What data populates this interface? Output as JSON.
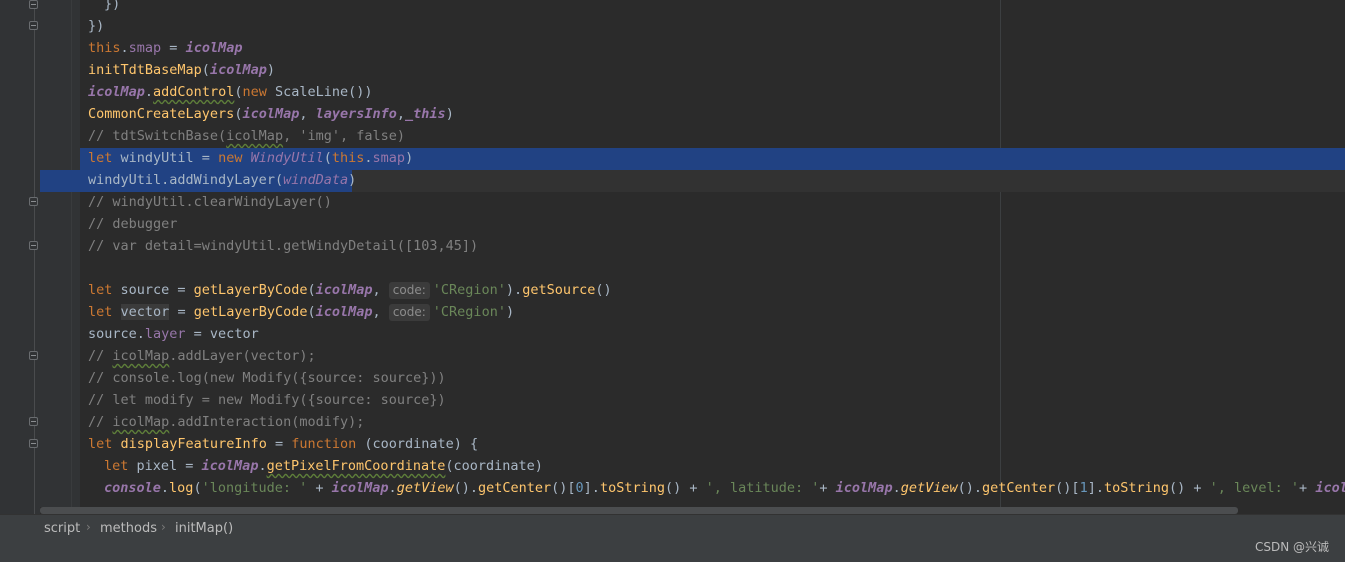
{
  "breadcrumb": {
    "items": [
      "script",
      "methods",
      "initMap()"
    ],
    "separator": "›"
  },
  "watermark": "CSDN @兴诚",
  "colors": {
    "editor_bg": "#2b2b2b",
    "gutter_bg": "#313335",
    "selection": "#214283",
    "keyword": "#cc7832",
    "function": "#ffc66d",
    "property": "#9876aa",
    "comment": "#808080",
    "string": "#6a8759",
    "number": "#6897bb",
    "default_text": "#a9b7c6"
  },
  "code": {
    "l01": [
      "})"
    ],
    "l02": [
      "})"
    ],
    "l03": [
      "this",
      ".",
      "smap",
      " = ",
      "icolMap"
    ],
    "l04": [
      "initTdtBaseMap",
      "(",
      "icolMap",
      ")"
    ],
    "l05": [
      "icolMap",
      ".",
      "addControl",
      "(",
      "new",
      " ScaleLine())"
    ],
    "l06": [
      "CommonCreateLayers",
      "(",
      "icolMap",
      ", ",
      "layersInfo",
      ",",
      "_this",
      ")"
    ],
    "l07": [
      "// tdtSwitchBase(",
      "icolMap",
      ", 'img', false)"
    ],
    "l08": [
      "let",
      " windyUtil = ",
      "new",
      " ",
      "WindyUtil",
      "(",
      "this",
      ".",
      "smap",
      ")"
    ],
    "l09": [
      "windyUtil.",
      "addWindyLayer",
      "(",
      "windData",
      ")"
    ],
    "l10": [
      "// windyUtil.clearWindyLayer()"
    ],
    "l11": [
      "// debugger"
    ],
    "l12": [
      "// var detail=windyUtil.getWindyDetail([103,45])"
    ],
    "l14": [
      "let",
      " source = ",
      "getLayerByCode",
      "(",
      "icolMap",
      ", ",
      "code:",
      "'CRegion'",
      ").",
      "getSource",
      "()"
    ],
    "l15": [
      "let",
      " ",
      "vector",
      " = ",
      "getLayerByCode",
      "(",
      "icolMap",
      ", ",
      "code:",
      "'CRegion'",
      ")"
    ],
    "l16": [
      "source.",
      "layer",
      " = vector"
    ],
    "l17": [
      "// ",
      "icolMap",
      ".addLayer(vector);"
    ],
    "l18": [
      "// console.log(new Modify({source: source}))"
    ],
    "l19": [
      "// let modify = new Modify({source: source})"
    ],
    "l20": [
      "// ",
      "icolMap",
      ".addInteraction(modify);"
    ],
    "l21": [
      "let",
      " ",
      "displayFeatureInfo",
      " = ",
      "function",
      " (coordinate) {"
    ],
    "l22": [
      "let",
      " pixel = ",
      "icolMap",
      ".",
      "getPixelFromCoordinate",
      "(coordinate)"
    ],
    "l23": [
      "console",
      ".",
      "log",
      "(",
      "'longitude: '",
      " + ",
      "icolMap",
      ".",
      "getView",
      "().",
      "getCenter",
      "()[",
      "0",
      "].",
      "toString",
      "() + ",
      "', latitude: '",
      "+ ",
      "icolMap",
      ".",
      "getView",
      "().",
      "getCenter",
      "()[",
      "1",
      "].",
      "toString",
      "() + ",
      "', level: '",
      "+ ",
      "icolMap"
    ]
  }
}
